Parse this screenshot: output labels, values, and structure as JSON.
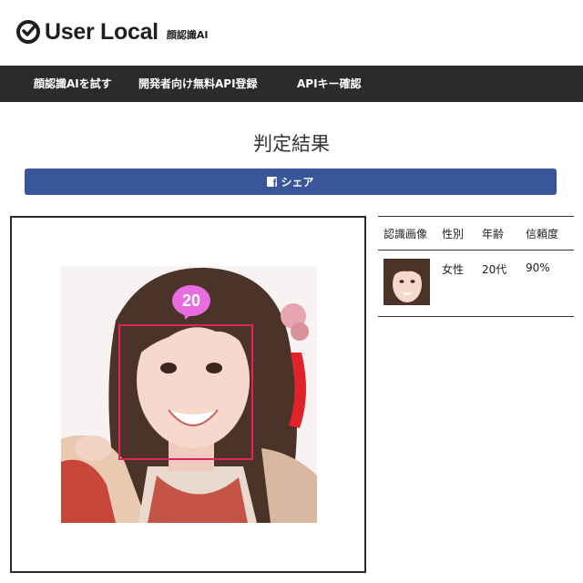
{
  "header": {
    "brand": "User Local",
    "product": "顔認識AI"
  },
  "nav": {
    "items": [
      {
        "label": "顔認識AIを試す"
      },
      {
        "label": "開発者向け無料API登録"
      },
      {
        "label": "APIキー確認"
      }
    ]
  },
  "main": {
    "title": "判定結果",
    "share_label": "シェア",
    "age_badge": "20"
  },
  "results": {
    "headers": [
      "認識画像",
      "性別",
      "年齢",
      "信頼度"
    ],
    "rows": [
      {
        "gender": "女性",
        "age": "20代",
        "confidence": "90%"
      }
    ]
  },
  "colors": {
    "nav_bg": "#2b2b2b",
    "share_bg": "#385699",
    "face_box": "#e0245e",
    "age_badge": "#e86de0"
  }
}
